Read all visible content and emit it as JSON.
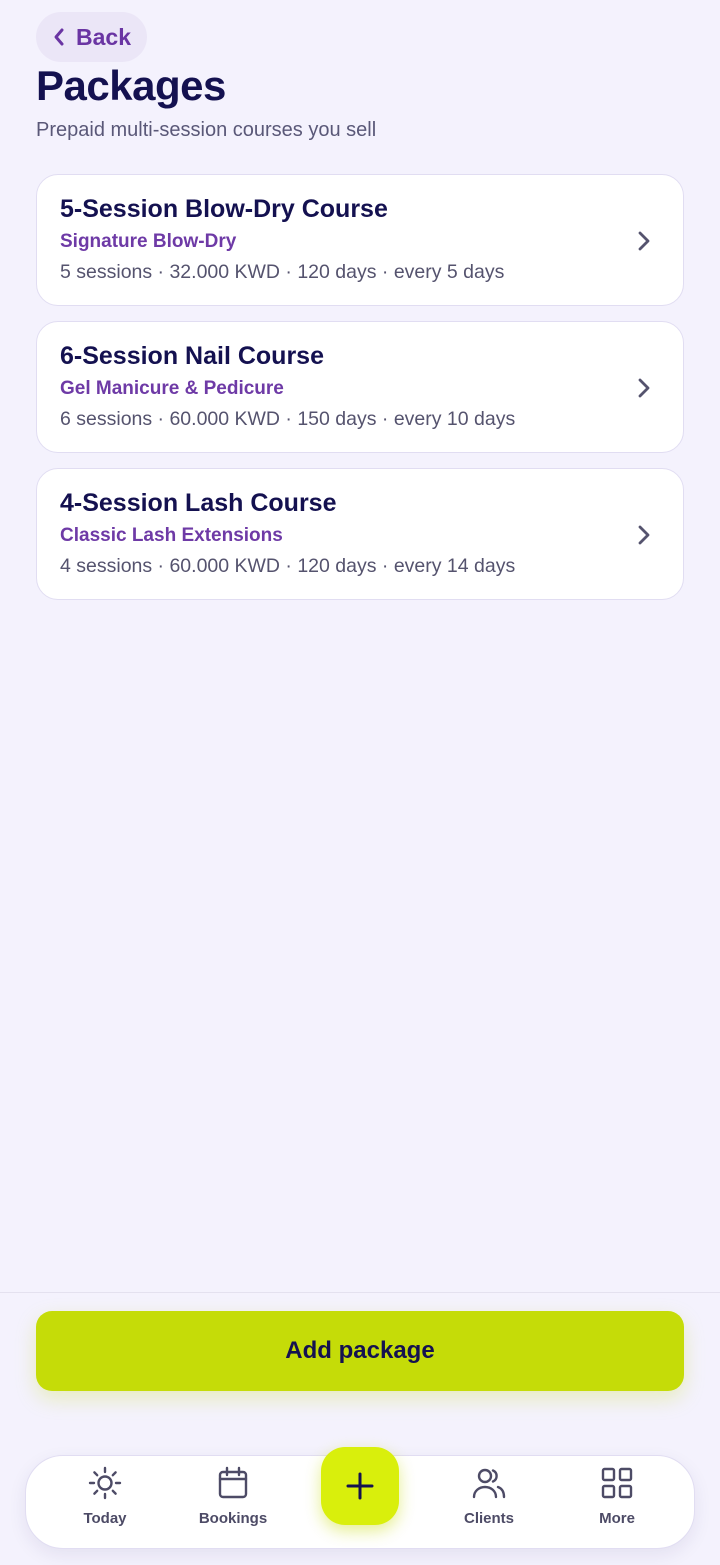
{
  "header": {
    "back_label": "Back",
    "title": "Packages",
    "subtitle": "Prepaid multi-session courses you sell"
  },
  "packages": [
    {
      "name": "5-Session Blow-Dry Course",
      "service": "Signature Blow-Dry",
      "meta": "5 sessions · 32.000 KWD · 120 days · every 5 days"
    },
    {
      "name": "6-Session Nail Course",
      "service": "Gel Manicure & Pedicure",
      "meta": "6 sessions · 60.000 KWD · 150 days · every 10 days"
    },
    {
      "name": "4-Session Lash Course",
      "service": "Classic Lash Extensions",
      "meta": "4 sessions · 60.000 KWD · 120 days · every 14 days"
    }
  ],
  "actions": {
    "add_label": "Add package"
  },
  "tabbar": {
    "today": "Today",
    "bookings": "Bookings",
    "clients": "Clients",
    "more": "More"
  },
  "icons": {
    "back": "chevron-left-icon",
    "row": "chevron-right-icon",
    "today": "sun-icon",
    "bookings": "calendar-icon",
    "add": "plus-icon",
    "clients": "users-icon",
    "more": "grid-icon"
  },
  "colors": {
    "background": "#f4f2fd",
    "accent": "#c5dc08",
    "fab": "#d9ef0c",
    "primary_text": "#141150",
    "service_text": "#6e3aa6"
  }
}
